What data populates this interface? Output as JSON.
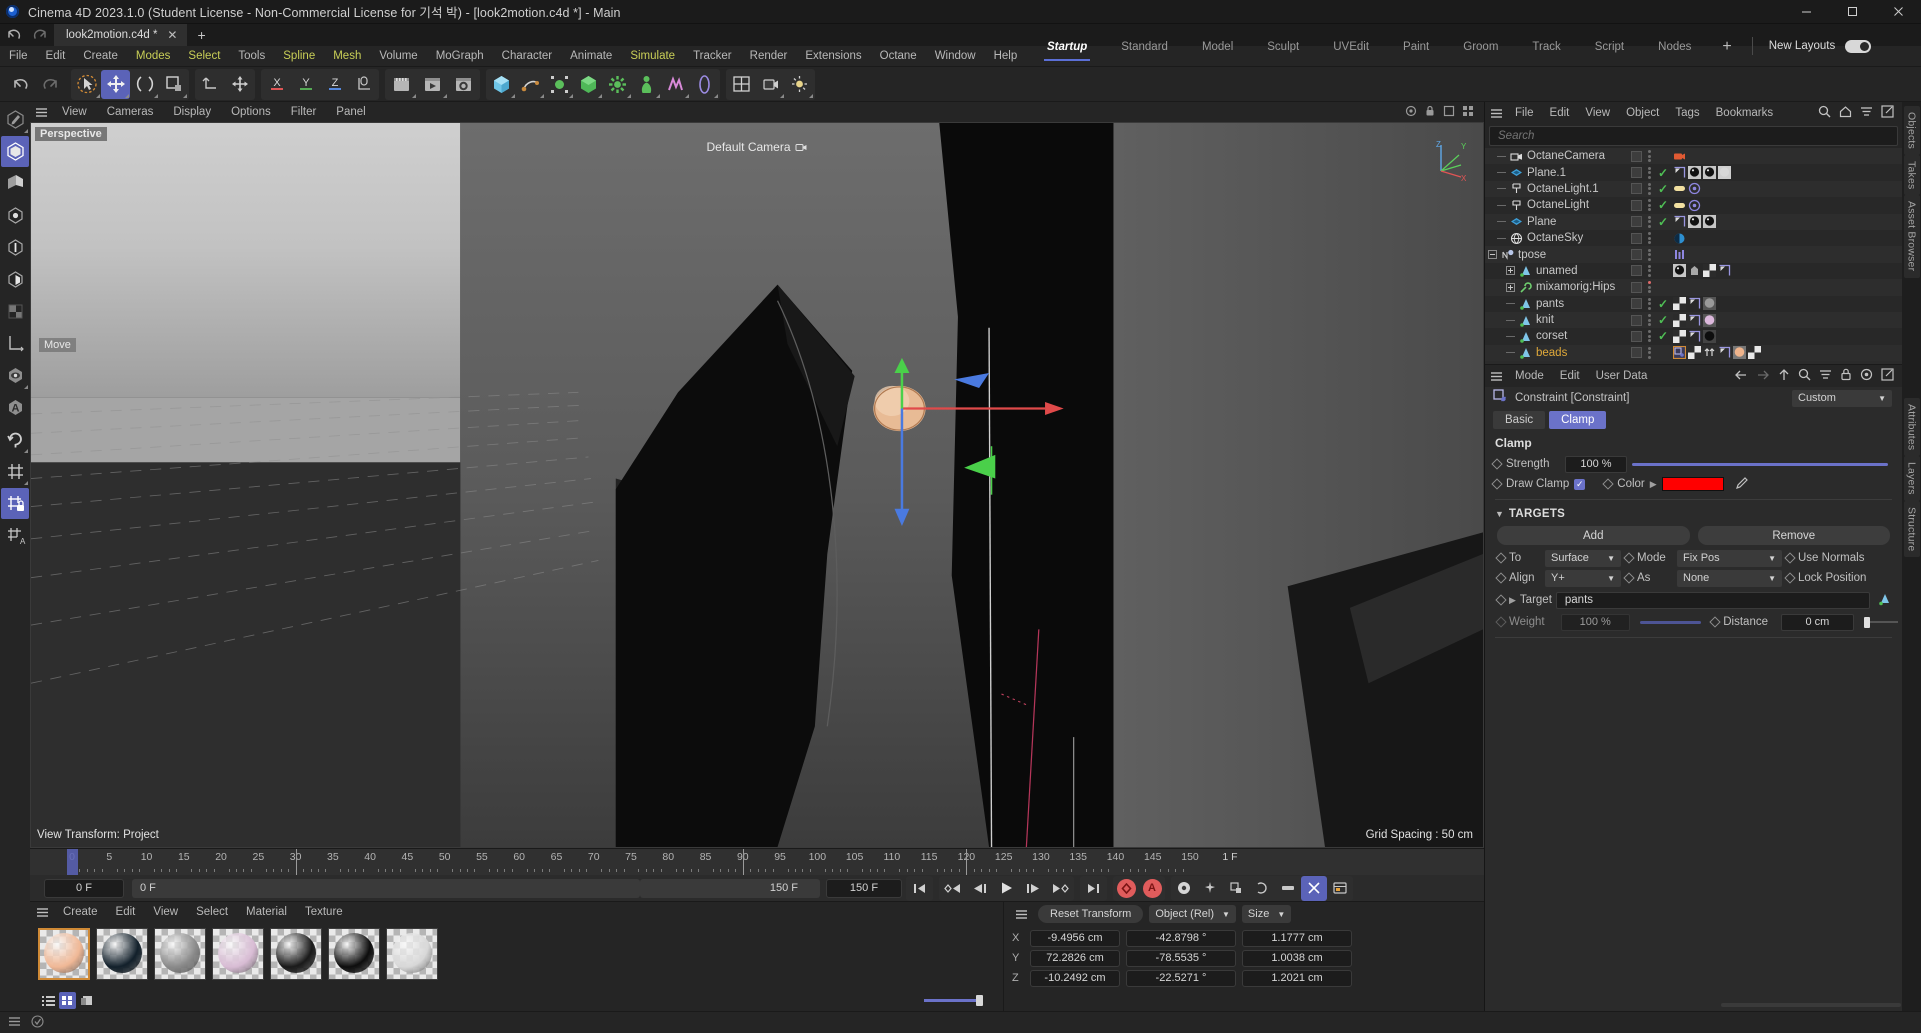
{
  "titlebar": {
    "title": "Cinema 4D 2023.1.0 (Student License - Non-Commercial License for 기석 박) - [look2motion.c4d *] - Main",
    "minimize": "─",
    "maximize": "☐",
    "close": "✕"
  },
  "doctab": {
    "name": "look2motion.c4d *",
    "close": "✕",
    "add": "+"
  },
  "menu": {
    "items": [
      {
        "label": "File",
        "hl": false
      },
      {
        "label": "Edit",
        "hl": false
      },
      {
        "label": "Create",
        "hl": false
      },
      {
        "label": "Modes",
        "hl": true
      },
      {
        "label": "Select",
        "hl": true
      },
      {
        "label": "Tools",
        "hl": false
      },
      {
        "label": "Spline",
        "hl": true
      },
      {
        "label": "Mesh",
        "hl": true
      },
      {
        "label": "Volume",
        "hl": false
      },
      {
        "label": "MoGraph",
        "hl": false
      },
      {
        "label": "Character",
        "hl": false
      },
      {
        "label": "Animate",
        "hl": false
      },
      {
        "label": "Simulate",
        "hl": true
      },
      {
        "label": "Tracker",
        "hl": false
      },
      {
        "label": "Render",
        "hl": false
      },
      {
        "label": "Extensions",
        "hl": false
      },
      {
        "label": "Octane",
        "hl": false
      },
      {
        "label": "Window",
        "hl": false
      },
      {
        "label": "Help",
        "hl": false
      }
    ]
  },
  "layouts": {
    "tabs": [
      "Startup",
      "Standard",
      "Model",
      "Sculpt",
      "UVEdit",
      "Paint",
      "Groom",
      "Track",
      "Script",
      "Nodes"
    ],
    "active": "Startup",
    "plus": "+",
    "new_layouts_label": "New Layouts",
    "toggle_on": true
  },
  "viewport": {
    "menu": [
      "View",
      "Cameras",
      "Display",
      "Options",
      "Filter",
      "Panel"
    ],
    "label": "Perspective",
    "camera": "Default Camera",
    "move_tag": "Move",
    "transform": "View Transform: Project",
    "grid_spacing": "Grid Spacing : 50 cm",
    "axis_x": "X",
    "axis_y": "Y",
    "axis_z": "Z"
  },
  "timeline": {
    "ticks": [
      0,
      5,
      10,
      15,
      20,
      25,
      30,
      35,
      40,
      45,
      50,
      55,
      60,
      65,
      70,
      75,
      80,
      85,
      90,
      95,
      100,
      105,
      110,
      115,
      120,
      125,
      130,
      135,
      140,
      145,
      150
    ],
    "current_frame_right": "1 F",
    "current_frame": "0 F",
    "current_frame_field": "0 F",
    "range_end": "150 F",
    "range_end_field": "150 F",
    "playhead_frame": 0
  },
  "materials": {
    "menu": [
      "Create",
      "Edit",
      "View",
      "Select",
      "Material",
      "Texture"
    ],
    "swatches": [
      {
        "name": "skin",
        "color": "#f0b896",
        "selected": true
      },
      {
        "name": "dark-navy",
        "color": "#12202b",
        "selected": false
      },
      {
        "name": "grey",
        "color": "#8a8a8a",
        "selected": false
      },
      {
        "name": "pink",
        "color": "#d8bcd4",
        "selected": false
      },
      {
        "name": "black-gloss",
        "color": "#1a1a1a",
        "selected": false
      },
      {
        "name": "black-shiny",
        "color": "#0d0d0d",
        "selected": false
      },
      {
        "name": "white",
        "color": "#d8d8d8",
        "selected": false
      }
    ]
  },
  "coordinates": {
    "reset_label": "Reset Transform",
    "space": "Object (Rel)",
    "sizemode": "Size",
    "rows": [
      {
        "axis": "X",
        "position": "-9.4956 cm",
        "rotation": "-42.8798 °",
        "size": "1.1777 cm"
      },
      {
        "axis": "Y",
        "position": "72.2826 cm",
        "rotation": "-78.5535 °",
        "size": "1.0038 cm"
      },
      {
        "axis": "Z",
        "position": "-10.2492 cm",
        "rotation": "-22.5271 °",
        "size": "1.2021 cm"
      }
    ]
  },
  "objectmanager": {
    "menu": [
      "File",
      "Edit",
      "View",
      "Object",
      "Tags",
      "Bookmarks"
    ],
    "search_placeholder": "Search",
    "items": [
      {
        "name": "OctaneCamera",
        "indent": 1,
        "icon": "camera",
        "check": false,
        "expander": "",
        "tags": [
          "cam-red"
        ]
      },
      {
        "name": "Plane.1",
        "indent": 1,
        "icon": "plane",
        "check": true,
        "expander": "",
        "tags": [
          "flag",
          "sphere-dark",
          "sphere-dark",
          "sphere-light"
        ]
      },
      {
        "name": "OctaneLight.1",
        "indent": 1,
        "icon": "light",
        "check": true,
        "expander": "",
        "tags": [
          "light-strip",
          "target"
        ]
      },
      {
        "name": "OctaneLight",
        "indent": 1,
        "icon": "light",
        "check": true,
        "expander": "",
        "tags": [
          "light-strip",
          "target"
        ]
      },
      {
        "name": "Plane",
        "indent": 1,
        "icon": "plane",
        "check": true,
        "expander": "",
        "tags": [
          "flag",
          "sphere-dark",
          "sphere-dark"
        ]
      },
      {
        "name": "OctaneSky",
        "indent": 1,
        "icon": "sky",
        "check": false,
        "expander": "",
        "tags": [
          "halfcircle"
        ]
      },
      {
        "name": "tpose",
        "indent": 0,
        "icon": "null",
        "check": false,
        "expander": "minus",
        "tags": [
          "bars"
        ]
      },
      {
        "name": "unamed",
        "indent": 2,
        "icon": "joint",
        "check": false,
        "expander": "plus",
        "tags": [
          "sphere-dark",
          "bag",
          "checker",
          "flag"
        ]
      },
      {
        "name": "mixamorig:Hips",
        "indent": 2,
        "icon": "wrench",
        "check": false,
        "expander": "plus",
        "tags": [],
        "reddot": true
      },
      {
        "name": "pants",
        "indent": 2,
        "icon": "joint",
        "check": true,
        "expander": "",
        "tags": [
          "checker",
          "flag",
          "sphere-grey"
        ]
      },
      {
        "name": "knit",
        "indent": 2,
        "icon": "joint",
        "check": true,
        "expander": "",
        "tags": [
          "checker",
          "flag",
          "sphere-pink"
        ]
      },
      {
        "name": "corset",
        "indent": 2,
        "icon": "joint",
        "check": true,
        "expander": "",
        "tags": [
          "checker",
          "flag",
          "sphere-black"
        ]
      },
      {
        "name": "beads",
        "indent": 2,
        "icon": "joint",
        "check": false,
        "expander": "",
        "selected": true,
        "tags": [
          "constraint-sel",
          "checker",
          "arrows",
          "flag",
          "sphere-skin",
          "checker"
        ]
      }
    ]
  },
  "attributes": {
    "menu": [
      "Mode",
      "Edit",
      "User Data"
    ],
    "object_title": "Constraint [Constraint]",
    "preset": "Custom",
    "tabs": [
      {
        "label": "Basic",
        "active": false
      },
      {
        "label": "Clamp",
        "active": true
      }
    ],
    "section_title": "Clamp",
    "strength_label": "Strength",
    "strength_value": "100 %",
    "draw_clamp_label": "Draw Clamp",
    "draw_clamp_checked": true,
    "color_label": "Color",
    "color_value": "#ff0000",
    "targets_title": "TARGETS",
    "add_label": "Add",
    "remove_label": "Remove",
    "to_label": "To",
    "to_value": "Surface",
    "mode_label": "Mode",
    "mode_value": "Fix Pos",
    "use_normals_label": "Use Normals",
    "align_label": "Align",
    "align_value": "Y+",
    "as_label": "As",
    "as_value": "None",
    "lock_position_label": "Lock Position",
    "target_label": "Target",
    "target_value": "pants",
    "weight_label": "Weight",
    "weight_value": "100 %",
    "distance_label": "Distance",
    "distance_value": "0 cm"
  },
  "vtabs_right": [
    "Objects",
    "Takes",
    "Asset Browser"
  ],
  "vtabs_right2": [
    "Attributes",
    "Layers",
    "Structure"
  ],
  "statusbar": {
    "text": ""
  }
}
